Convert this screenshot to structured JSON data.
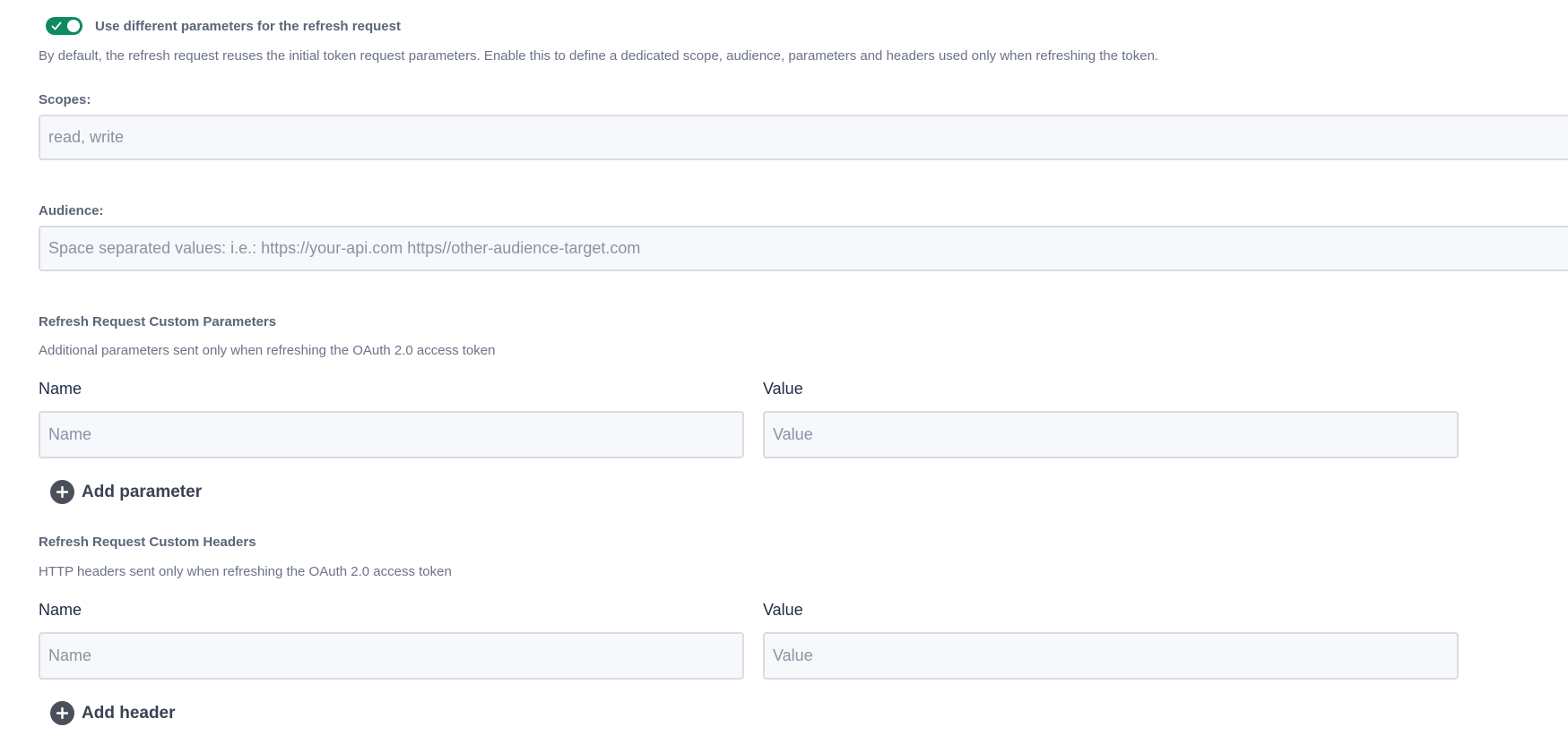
{
  "refresh_toggle": {
    "label": "Use different parameters for the refresh request",
    "enabled": true,
    "color": "#0e8a5f",
    "icon": "check-icon"
  },
  "description": "By default, the refresh request reuses the initial token request parameters. Enable this to define a dedicated scope, audience, parameters and headers used only when refreshing the token.",
  "scopes": {
    "label": "Scopes:",
    "value": "",
    "placeholder": "read, write"
  },
  "audience": {
    "label": "Audience:",
    "value": "",
    "placeholder": "Space separated values: i.e.: https://your-api.com https//other-audience-target.com"
  },
  "custom_parameters": {
    "title": "Refresh Request Custom Parameters",
    "description": "Additional parameters sent only when refreshing the OAuth 2.0 access token",
    "name_label": "Name",
    "value_label": "Value",
    "name_placeholder": "Name",
    "value_placeholder": "Value",
    "add_label": "Add parameter",
    "add_icon": "plus-circle-icon"
  },
  "custom_headers": {
    "title": "Refresh Request Custom Headers",
    "description": "HTTP headers sent only when refreshing the OAuth 2.0 access token",
    "name_label": "Name",
    "value_label": "Value",
    "name_placeholder": "Name",
    "value_placeholder": "Value",
    "add_label": "Add header",
    "add_icon": "plus-circle-icon"
  }
}
